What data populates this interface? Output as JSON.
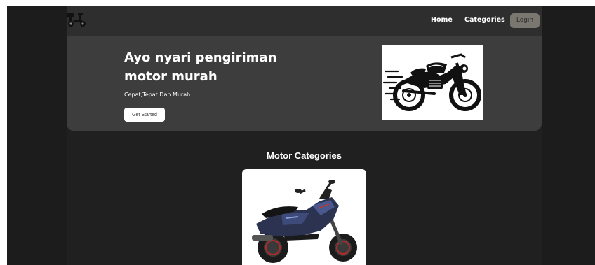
{
  "navbar": {
    "logo_icon": "scooter-logo-icon",
    "links": [
      "Home",
      "Categories"
    ],
    "login_label": "Login"
  },
  "hero": {
    "title": "Ayo nyari pengiriman motor murah",
    "subtitle": "Cepat,Tepat Dan Murah",
    "cta_label": "Get Started",
    "image_icon": "motorcycle-illustration"
  },
  "categories": {
    "title": "Motor Categories",
    "cards": [
      {
        "image_icon": "sport-scooter-photo"
      }
    ]
  },
  "colors": {
    "page_bg": "#202020",
    "navbar_bg": "#2e2e2e",
    "hero_bg": "#3d3d3d",
    "login_bg": "#7a7670",
    "text": "#ffffff"
  }
}
